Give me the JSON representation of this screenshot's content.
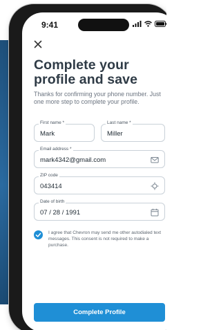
{
  "status_bar": {
    "time": "9:41"
  },
  "form": {
    "title": "Complete your profile and save",
    "subtitle": "Thanks for confirming your phone number. Just one more step to complete your profile.",
    "first_name": {
      "label": "First name *",
      "value": "Mark"
    },
    "last_name": {
      "label": "Last name *",
      "value": "Miller"
    },
    "email": {
      "label": "Email address *",
      "value": "mark4342@gmail.com",
      "icon": "mail-icon"
    },
    "zip": {
      "label": "ZIP code",
      "value": "043414",
      "icon": "location-icon"
    },
    "dob": {
      "label": "Date of birth",
      "value": "07 / 28 / 1991",
      "icon": "calendar-icon"
    },
    "consent": {
      "checked": true,
      "text": "I agree that Chevron may send me other autodialed text messages. This consent is not required to make a purchase."
    },
    "submit_label": "Complete Profile"
  },
  "colors": {
    "accent": "#1f8fd6",
    "title": "#2f3b46",
    "background_panel": "#1e4f7a"
  }
}
